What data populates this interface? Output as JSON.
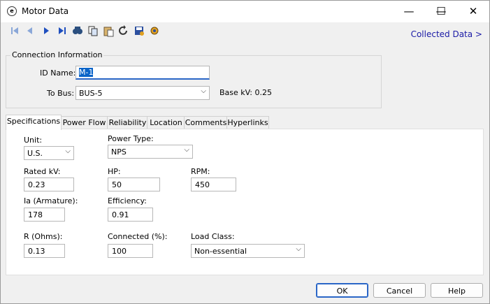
{
  "window": {
    "title": "Motor Data",
    "app_icon_glyph": "e"
  },
  "window_controls": {
    "minimize": "—",
    "maximize": "☐",
    "close": "✕"
  },
  "toolbar": {
    "icons": [
      "first-record-icon",
      "previous-record-icon",
      "next-record-icon",
      "last-record-icon",
      "find-icon",
      "copy-icon",
      "paste-icon",
      "undo-icon",
      "save-icon",
      "settings-icon"
    ],
    "collected_data_link": "Collected Data >"
  },
  "connection": {
    "group_label": "Connection Information",
    "id_label": "ID Name:",
    "id_value": "M-1",
    "bus_label": "To Bus:",
    "bus_value": "BUS-5",
    "base_kv": "Base kV: 0.25"
  },
  "tabs": [
    {
      "label": "Specifications",
      "active": true
    },
    {
      "label": "Power Flow"
    },
    {
      "label": "Reliability"
    },
    {
      "label": "Location"
    },
    {
      "label": "Comments"
    },
    {
      "label": "Hyperlinks"
    }
  ],
  "specs": {
    "unit_label": "Unit:",
    "unit_value": "U.S.",
    "power_type_label": "Power Type:",
    "power_type_value": "NPS",
    "rated_kv_label": "Rated kV:",
    "rated_kv_value": "0.23",
    "hp_label": "HP:",
    "hp_value": "50",
    "rpm_label": "RPM:",
    "rpm_value": "450",
    "ia_label": "Ia (Armature):",
    "ia_value": "178",
    "efficiency_label": "Efficiency:",
    "efficiency_value": "0.91",
    "r_label": "R (Ohms):",
    "r_value": "0.13",
    "connected_label": "Connected (%):",
    "connected_value": "100",
    "load_class_label": "Load Class:",
    "load_class_value": "Non-essential"
  },
  "buttons": {
    "ok": "OK",
    "cancel": "Cancel",
    "help": "Help"
  },
  "colors": {
    "accent": "#2a66c7",
    "link": "#1a1aa6",
    "selection": "#0a64c8"
  }
}
